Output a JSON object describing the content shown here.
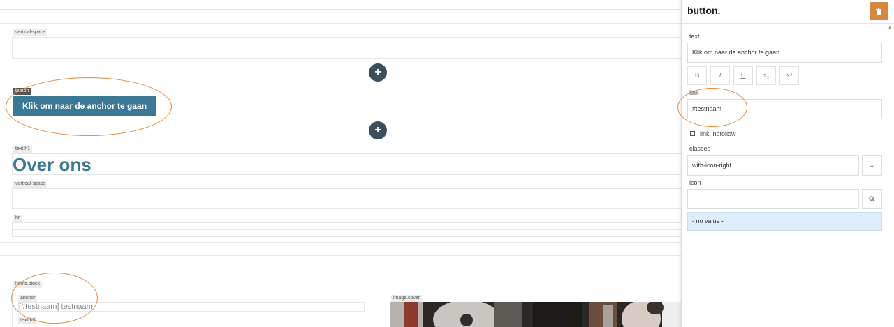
{
  "canvas": {
    "tags": {
      "vertical_space_1": "vertical-space",
      "button": "button",
      "text_h1": "text.h1",
      "vertical_space_2": "vertical-space",
      "hr": "hr",
      "items_block": "items.block",
      "anchor": "anchor",
      "text_h2": "text-h2",
      "image_cover": "image.cover"
    },
    "button_label": "Klik om naar de anchor te gaan",
    "heading": "Over ons",
    "anchor_value": "[#testnaam] testnaam",
    "add_icon": "plus-icon"
  },
  "panel": {
    "title": "button.",
    "delete_icon": "trash-icon",
    "text_label": "text",
    "text_value": "Klik om naar de anchor te gaan",
    "format_buttons": [
      "B",
      "I",
      "U",
      "x₂",
      "x²"
    ],
    "link_label": "link",
    "link_value": "#testnaam",
    "nofollow_label": "link_nofollow",
    "classes_label": "classes",
    "classes_value": "with-icon-right",
    "icon_label": "icon",
    "icon_value": "",
    "no_value_option": "- no value -"
  },
  "colors": {
    "accent_blue": "#3a7896",
    "delete_orange": "#d5893f",
    "highlight_ellipse": "#e8893a",
    "option_highlight": "#dfeefc"
  }
}
